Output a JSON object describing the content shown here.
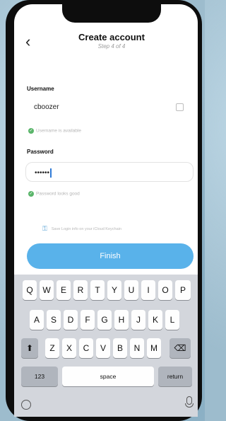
{
  "header": {
    "back_glyph": "‹",
    "title": "Create account",
    "step": "Step 4 of 4"
  },
  "form": {
    "username_label": "Username",
    "username_value": "cboozer",
    "username_hint": "Username is available",
    "password_label": "Password",
    "password_value": "••••••",
    "password_hint": "Password looks good",
    "save_text": "Save Login info on your iCloud Keychain"
  },
  "finish_label": "Finish",
  "keyboard": {
    "row1": [
      "Q",
      "W",
      "E",
      "R",
      "T",
      "Y",
      "U",
      "I",
      "O",
      "P"
    ],
    "row2": [
      "A",
      "S",
      "D",
      "F",
      "G",
      "H",
      "J",
      "K",
      "L"
    ],
    "row3": [
      "Z",
      "X",
      "C",
      "V",
      "B",
      "N",
      "M"
    ],
    "shift_glyph": "⬆",
    "delete_glyph": "⌫",
    "numbers_label": "123",
    "space_label": "space",
    "return_label": "return"
  },
  "colors": {
    "accent": "#59b2ea",
    "success": "#5ab56a"
  }
}
